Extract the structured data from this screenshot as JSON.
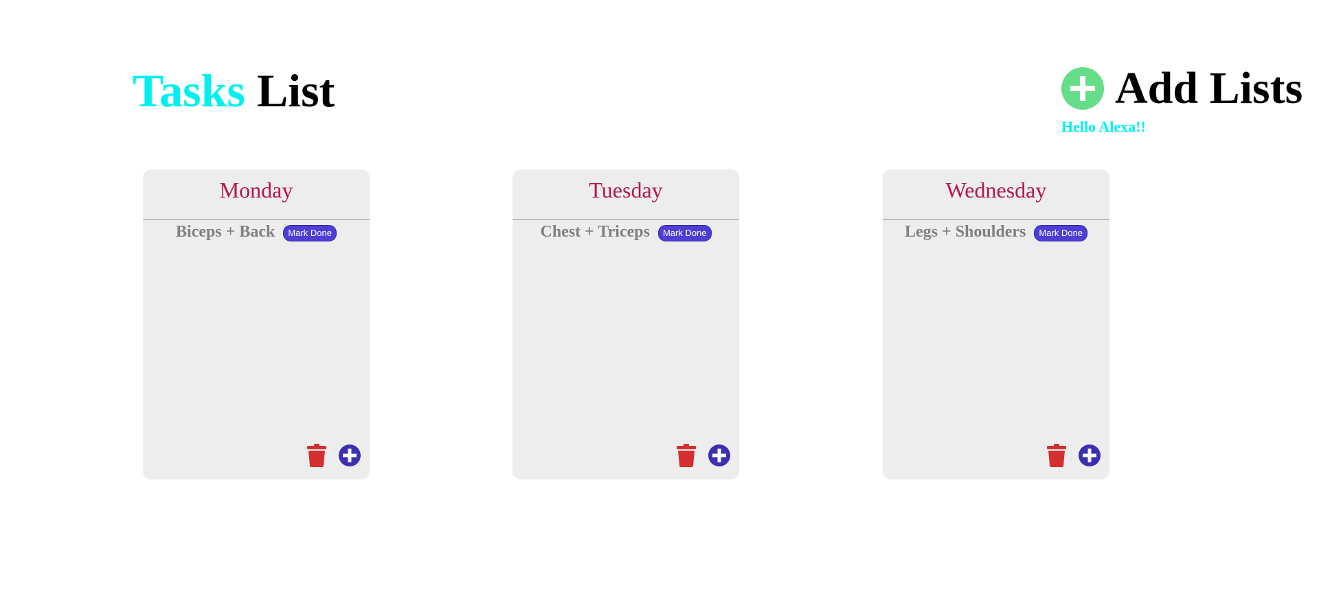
{
  "header": {
    "title_accent": "Tasks",
    "title_main": "List",
    "add_lists_label": "Add Lists",
    "add_lists_icon": "plus-circle-icon",
    "greeting": "Hello Alexa!!"
  },
  "colors": {
    "title_accent": "#00f0f0",
    "add_icon": "#66dd88",
    "day_title": "#b5174a",
    "card_bg": "#ededed",
    "task_text": "#808080",
    "mark_done_bg": "#4d3fd6",
    "trash": "#d32f2f",
    "add_task": "#3a2fb0"
  },
  "lists": [
    {
      "day": "Monday",
      "tasks": [
        {
          "text": "Biceps + Back",
          "action_label": "Mark Done"
        }
      ],
      "delete_icon": "trash-icon",
      "add_icon": "plus-circle-icon"
    },
    {
      "day": "Tuesday",
      "tasks": [
        {
          "text": "Chest + Triceps",
          "action_label": "Mark Done"
        }
      ],
      "delete_icon": "trash-icon",
      "add_icon": "plus-circle-icon"
    },
    {
      "day": "Wednesday",
      "tasks": [
        {
          "text": "Legs + Shoulders",
          "action_label": "Mark Done"
        }
      ],
      "delete_icon": "trash-icon",
      "add_icon": "plus-circle-icon"
    }
  ]
}
